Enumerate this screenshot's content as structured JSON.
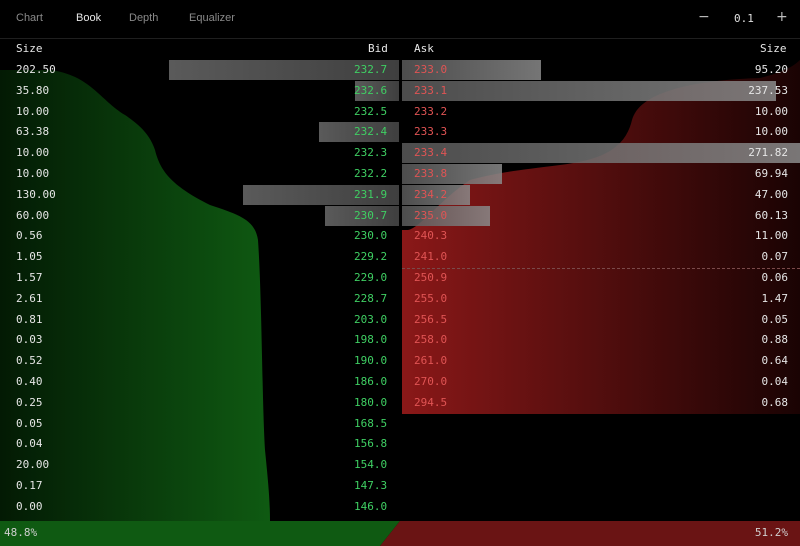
{
  "tabs": [
    {
      "label": "Chart",
      "active": false
    },
    {
      "label": "Book",
      "active": true
    },
    {
      "label": "Depth",
      "active": false
    },
    {
      "label": "Equalizer",
      "active": false
    }
  ],
  "zoom": {
    "minus": "−",
    "value": "0.1",
    "plus": "+"
  },
  "headers": {
    "bid_size": "Size",
    "bid": "Bid",
    "ask": "Ask",
    "ask_size": "Size"
  },
  "colors": {
    "bid": "#3fcf63",
    "ask": "#e05454",
    "bid_fill": "#0f5a12",
    "ask_fill": "#8a1818"
  },
  "bids": [
    {
      "size": "202.50",
      "price": "232.7",
      "bar": 0.78
    },
    {
      "size": "35.80",
      "price": "232.6",
      "bar": 0.15
    },
    {
      "size": "10.00",
      "price": "232.5",
      "bar": 0
    },
    {
      "size": "63.38",
      "price": "232.4",
      "bar": 0.27
    },
    {
      "size": "10.00",
      "price": "232.3",
      "bar": 0
    },
    {
      "size": "10.00",
      "price": "232.2",
      "bar": 0
    },
    {
      "size": "130.00",
      "price": "231.9",
      "bar": 0.53
    },
    {
      "size": "60.00",
      "price": "230.7",
      "bar": 0.25
    },
    {
      "size": "0.56",
      "price": "230.0",
      "bar": 0
    },
    {
      "size": "1.05",
      "price": "229.2",
      "bar": 0
    },
    {
      "size": "1.57",
      "price": "229.0",
      "bar": 0
    },
    {
      "size": "2.61",
      "price": "228.7",
      "bar": 0
    },
    {
      "size": "0.81",
      "price": "203.0",
      "bar": 0
    },
    {
      "size": "0.03",
      "price": "198.0",
      "bar": 0
    },
    {
      "size": "0.52",
      "price": "190.0",
      "bar": 0
    },
    {
      "size": "0.40",
      "price": "186.0",
      "bar": 0
    },
    {
      "size": "0.25",
      "price": "180.0",
      "bar": 0
    },
    {
      "size": "0.05",
      "price": "168.5",
      "bar": 0
    },
    {
      "size": "0.04",
      "price": "156.8",
      "bar": 0
    },
    {
      "size": "20.00",
      "price": "154.0",
      "bar": 0
    },
    {
      "size": "0.17",
      "price": "147.3",
      "bar": 0
    },
    {
      "size": "0.00",
      "price": "146.0",
      "bar": 0
    }
  ],
  "asks": [
    {
      "price": "233.0",
      "size": "95.20",
      "bar": 0.35
    },
    {
      "price": "233.1",
      "size": "237.53",
      "bar": 0.94
    },
    {
      "price": "233.2",
      "size": "10.00",
      "bar": 0
    },
    {
      "price": "233.3",
      "size": "10.00",
      "bar": 0
    },
    {
      "price": "233.4",
      "size": "271.82",
      "bar": 1.0
    },
    {
      "price": "233.8",
      "size": "69.94",
      "bar": 0.25
    },
    {
      "price": "234.2",
      "size": "47.00",
      "bar": 0.17
    },
    {
      "price": "235.0",
      "size": "60.13",
      "bar": 0.22
    },
    {
      "price": "240.3",
      "size": "11.00",
      "bar": 0
    },
    {
      "price": "241.0",
      "size": "0.07",
      "bar": 0
    },
    {
      "price": "250.9",
      "size": "0.06",
      "bar": 0
    },
    {
      "price": "255.0",
      "size": "1.47",
      "bar": 0
    },
    {
      "price": "256.5",
      "size": "0.05",
      "bar": 0
    },
    {
      "price": "258.0",
      "size": "0.88",
      "bar": 0
    },
    {
      "price": "261.0",
      "size": "0.64",
      "bar": 0
    },
    {
      "price": "270.0",
      "size": "0.04",
      "bar": 0
    },
    {
      "price": "294.5",
      "size": "0.68",
      "bar": 0
    }
  ],
  "footer": {
    "bid_pct": "48.8%",
    "ask_pct": "51.2%",
    "bid_share": 0.488
  }
}
